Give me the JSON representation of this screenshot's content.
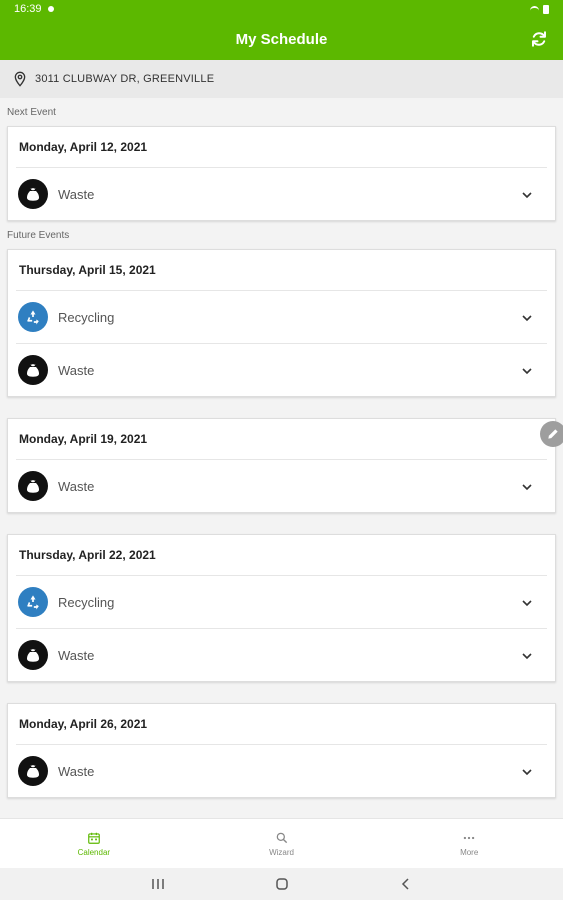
{
  "status_bar": {
    "time": "16:39"
  },
  "app_bar": {
    "title": "My Schedule",
    "refresh_icon": "refresh-icon"
  },
  "address": {
    "text": "3011 CLUBWAY DR, GREENVILLE",
    "icon": "location-pin-icon"
  },
  "sections": {
    "next_label": "Next Event",
    "future_label": "Future Events"
  },
  "cards": [
    {
      "date": "Monday, April 12, 2021",
      "items": [
        {
          "type": "waste",
          "label": "Waste"
        }
      ]
    },
    {
      "date": "Thursday, April 15, 2021",
      "items": [
        {
          "type": "recycling",
          "label": "Recycling"
        },
        {
          "type": "waste",
          "label": "Waste"
        }
      ]
    },
    {
      "date": "Monday, April 19, 2021",
      "items": [
        {
          "type": "waste",
          "label": "Waste"
        }
      ]
    },
    {
      "date": "Thursday, April 22, 2021",
      "items": [
        {
          "type": "recycling",
          "label": "Recycling"
        },
        {
          "type": "waste",
          "label": "Waste"
        }
      ]
    },
    {
      "date": "Monday, April 26, 2021",
      "items": [
        {
          "type": "waste",
          "label": "Waste"
        }
      ]
    }
  ],
  "bottom_nav": [
    {
      "label": "Calendar",
      "icon": "calendar-icon",
      "active": true
    },
    {
      "label": "Wizard",
      "icon": "search-icon",
      "active": false
    },
    {
      "label": "More",
      "icon": "more-icon",
      "active": false
    }
  ],
  "colors": {
    "brand_green": "#5cb800",
    "waste_icon": "#111111",
    "recycling_icon": "#2f7fc1"
  }
}
